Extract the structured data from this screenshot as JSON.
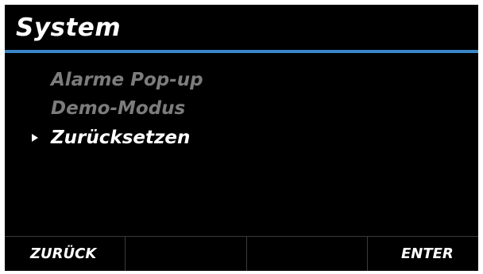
{
  "header": {
    "title": "System"
  },
  "menu": {
    "items": [
      {
        "label": "Alarme Pop-up",
        "state": "dim"
      },
      {
        "label": "Demo-Modus",
        "state": "dim"
      },
      {
        "label": "Zurücksetzen",
        "state": "selected"
      }
    ]
  },
  "softkeys": {
    "key1": "ZURÜCK",
    "key2": "",
    "key3": "",
    "key4": "ENTER"
  },
  "colors": {
    "background": "#000000",
    "accent": "#3b86c9",
    "text": "#ffffff",
    "dim_text": "#7c7c7c"
  },
  "icons": {
    "cursor": "right-triangle"
  }
}
